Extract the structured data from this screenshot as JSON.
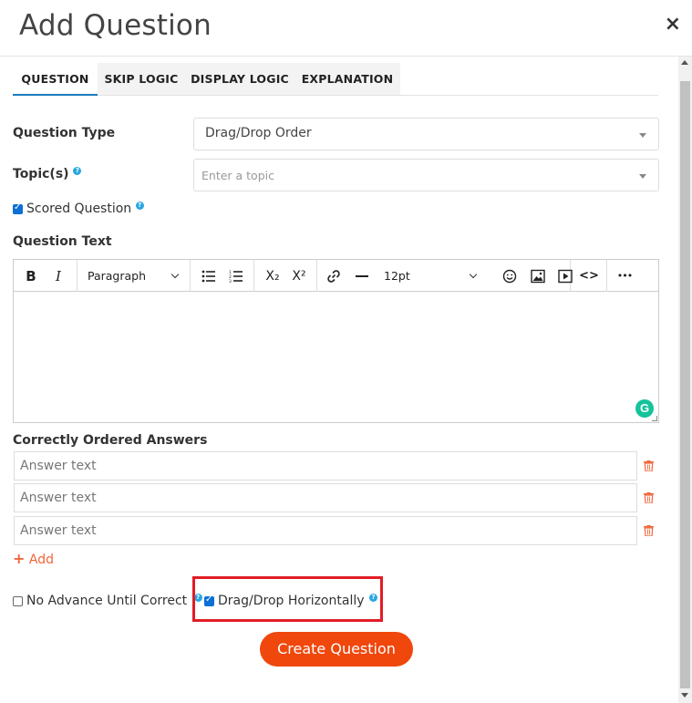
{
  "modal": {
    "title": "Add Question",
    "close_icon": "×"
  },
  "tabs": [
    {
      "label": "QUESTION",
      "active": true
    },
    {
      "label": "SKIP LOGIC",
      "active": false
    },
    {
      "label": "DISPLAY LOGIC",
      "active": false
    },
    {
      "label": "EXPLANATION",
      "active": false
    }
  ],
  "form": {
    "question_type_label": "Question Type",
    "question_type_value": "Drag/Drop Order",
    "topics_label": "Topic(s)",
    "topics_placeholder": "Enter a topic",
    "scored_label": "Scored Question",
    "scored_checked": true,
    "question_text_label": "Question Text",
    "help_icon": "?"
  },
  "editor_toolbar": {
    "bold": "B",
    "italic": "I",
    "block_format": "Paragraph",
    "bullet_list_icon": "bullet-list-icon",
    "numbered_list_icon": "numbered-list-icon",
    "subscript": "X₂",
    "superscript": "X²",
    "link_icon": "link-icon",
    "hr_icon": "horizontal-rule-icon",
    "font_size": "12pt",
    "emoji_icon": "emoji-icon",
    "image_icon": "image-icon",
    "media_icon": "media-icon",
    "code_icon": "<>",
    "more_icon": "•••",
    "grammarly": "G"
  },
  "answers": {
    "label": "Correctly Ordered Answers",
    "items": [
      {
        "placeholder": "Answer text"
      },
      {
        "placeholder": "Answer text"
      },
      {
        "placeholder": "Answer text"
      }
    ],
    "add_label": "Add",
    "add_icon": "+"
  },
  "options": {
    "no_advance_label": "No Advance Until Correct",
    "no_advance_checked": false,
    "horizontal_label": "Drag/Drop Horizontally",
    "horizontal_checked": true
  },
  "actions": {
    "create_label": "Create Question"
  },
  "colors": {
    "primary_button": "#f0470d",
    "tab_active_underline": "#1a7bbf",
    "help_icon": "#29a7e1",
    "trash_icon": "#f0663a",
    "highlight_border": "#e21c25"
  }
}
